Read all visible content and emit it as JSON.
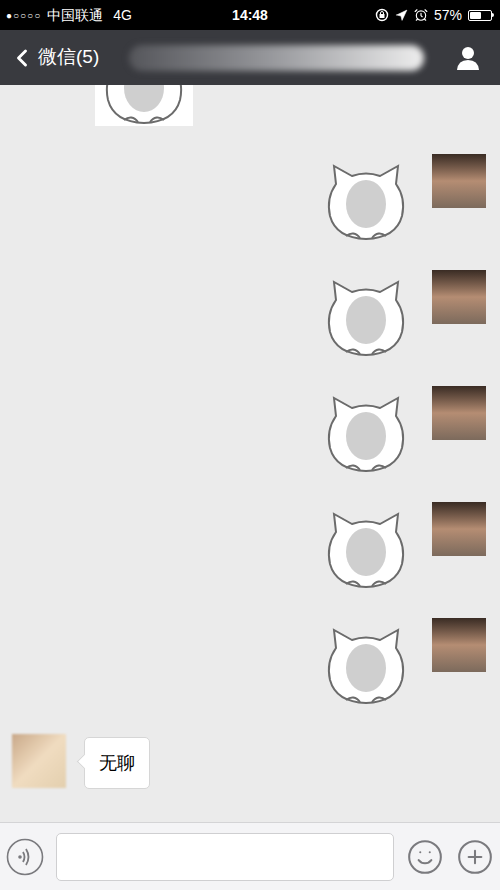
{
  "status_bar": {
    "signal": "●○○○○",
    "carrier": "中国联通",
    "network": "4G",
    "time": "14:48",
    "battery": "57%",
    "battery_level": 0.57
  },
  "nav_bar": {
    "back": "微信(5)"
  },
  "messages": [
    {
      "kind": "sticker",
      "from": "other",
      "cropped": true
    },
    {
      "kind": "sticker",
      "from": "me",
      "cropped": false
    },
    {
      "kind": "sticker",
      "from": "me",
      "cropped": false
    },
    {
      "kind": "sticker",
      "from": "me",
      "cropped": false
    },
    {
      "kind": "sticker",
      "from": "me",
      "cropped": false
    },
    {
      "kind": "sticker",
      "from": "me",
      "cropped": false
    },
    {
      "kind": "text",
      "from": "other",
      "text": "无聊"
    }
  ]
}
